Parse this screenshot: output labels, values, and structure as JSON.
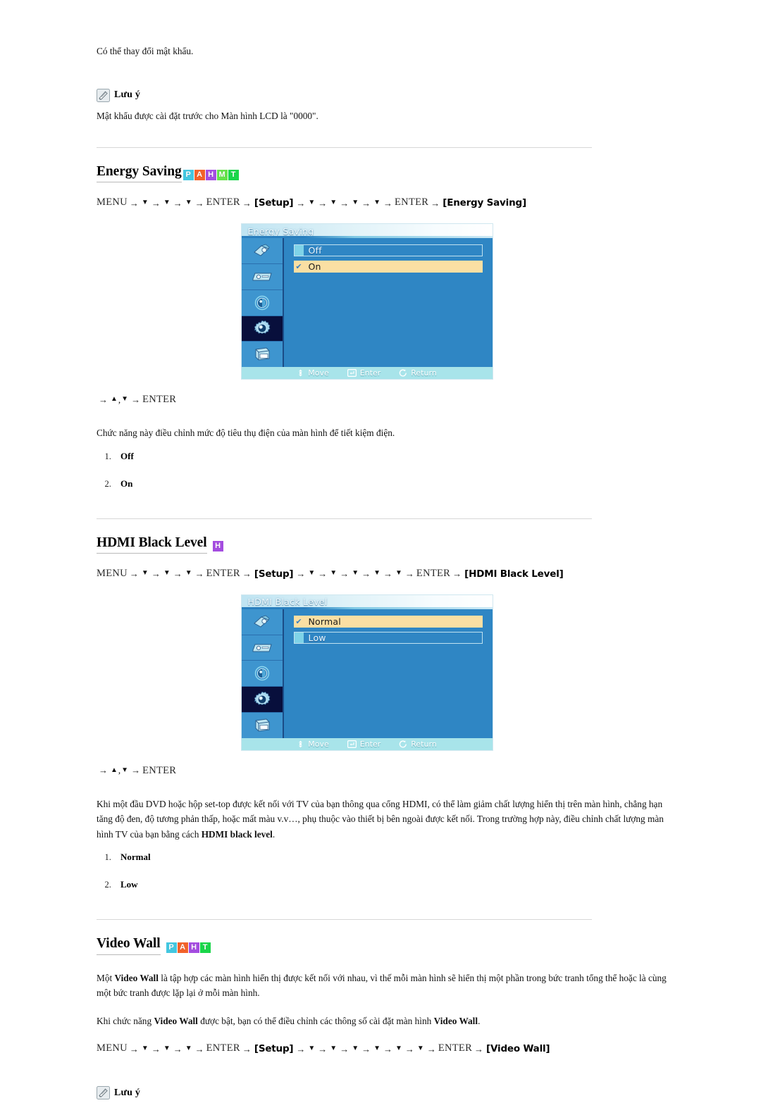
{
  "intro": {
    "line": "Có thể thay đổi mật khẩu."
  },
  "note_top": {
    "icon": "note-pencil-icon",
    "label": "Lưu ý",
    "body": "Mật khẩu được cài đặt trước cho Màn hình LCD là \"0000\"."
  },
  "sections": [
    {
      "id": "energy-saving",
      "title": "Energy Saving",
      "badges": [
        {
          "letter": "P",
          "color": "#43c7e0"
        },
        {
          "letter": "A",
          "color": "#f2622a"
        },
        {
          "letter": "H",
          "color": "#a44ce0"
        },
        {
          "letter": "M",
          "color": "#64e24a"
        },
        {
          "letter": "T",
          "color": "#1ad64a"
        }
      ],
      "menu_path": {
        "start": "MENU",
        "arrow": "→",
        "down": "▼",
        "down_count_1": 3,
        "enter": "ENTER",
        "osd_1": "[Setup]",
        "down_count_2": 4,
        "enter_2": "ENTER",
        "osd_2": "[Energy Saving]"
      },
      "osd": {
        "title": "Energy Saving",
        "rows": [
          {
            "label": "Off",
            "selected": false
          },
          {
            "label": "On",
            "selected": true
          }
        ],
        "footer": [
          {
            "icon": "move-icon",
            "label": "Move"
          },
          {
            "icon": "enter-icon",
            "label": "Enter"
          },
          {
            "icon": "return-icon",
            "label": "Return"
          }
        ],
        "side_icons": [
          "picture-icon",
          "sound-icon",
          "setup-circle-icon",
          "gear-icon",
          "multicontrol-icon"
        ],
        "active_side_index": 3
      },
      "short_path": {
        "arrow": "→",
        "up": "▲",
        "comma": ",",
        "down": "▼",
        "enter": "ENTER"
      },
      "description": "Chức năng này điều chỉnh mức độ tiêu thụ điện của màn hình để tiết kiệm điện.",
      "options": [
        "Off",
        "On"
      ]
    },
    {
      "id": "hdmi-black-level",
      "title": "HDMI Black Level",
      "badges": [
        {
          "letter": "H",
          "color": "#a44ce0"
        }
      ],
      "menu_path": {
        "start": "MENU",
        "arrow": "→",
        "down": "▼",
        "down_count_1": 3,
        "enter": "ENTER",
        "osd_1": "[Setup]",
        "down_count_2": 5,
        "enter_2": "ENTER",
        "osd_2": "[HDMI Black Level]"
      },
      "osd": {
        "title": "HDMI Black Level",
        "rows": [
          {
            "label": "Normal",
            "selected": true
          },
          {
            "label": "Low",
            "selected": false
          }
        ],
        "footer": [
          {
            "icon": "move-icon",
            "label": "Move"
          },
          {
            "icon": "enter-icon",
            "label": "Enter"
          },
          {
            "icon": "return-icon",
            "label": "Return"
          }
        ],
        "side_icons": [
          "picture-icon",
          "sound-icon",
          "setup-circle-icon",
          "gear-icon",
          "multicontrol-icon"
        ],
        "active_side_index": 3
      },
      "short_path": {
        "arrow": "→",
        "up": "▲",
        "comma": ",",
        "down": "▼",
        "enter": "ENTER"
      },
      "description_part1": "Khi một đầu DVD hoặc hộp set-top được kết nối với TV của bạn thông qua cổng HDMI, có thể làm giảm chất lượng hiển thị trên màn hình, chẳng hạn tăng độ đen, độ tương phản thấp, hoặc mất màu v.v…, phụ thuộc vào thiết bị bên ngoài được kết nối. Trong trường hợp này, điều chỉnh chất lượng màn hình TV của bạn bằng cách ",
      "description_bold": "HDMI black level",
      "description_part2": ".",
      "options": [
        "Normal",
        "Low"
      ]
    },
    {
      "id": "video-wall",
      "title": "Video Wall",
      "badges": [
        {
          "letter": "P",
          "color": "#43c7e0"
        },
        {
          "letter": "A",
          "color": "#f2622a"
        },
        {
          "letter": "H",
          "color": "#a44ce0"
        },
        {
          "letter": "T",
          "color": "#1ad64a"
        }
      ],
      "paragraph1_part1": "Một ",
      "paragraph1_bold": "Video Wall",
      "paragraph1_part2": " là tập hợp các màn hình hiển thị được kết nối với nhau, vì thế mỗi màn hình sẽ hiển thị một phần trong bức tranh tổng thể hoặc là cùng một bức tranh được lặp lại ở mỗi màn hình.",
      "paragraph2_part1": "Khi chức năng ",
      "paragraph2_bold1": "Video Wall",
      "paragraph2_part2": " được bật, bạn có thể điều chỉnh các thông số cài đặt màn hình ",
      "paragraph2_bold2": "Video Wall",
      "paragraph2_part3": ".",
      "menu_path": {
        "start": "MENU",
        "arrow": "→",
        "down": "▼",
        "down_count_1": 3,
        "enter": "ENTER",
        "osd_1": "[Setup]",
        "down_count_2": 6,
        "enter_2": "ENTER",
        "osd_2": "[Video Wall]"
      }
    }
  ],
  "note_bottom": {
    "icon": "note-pencil-icon",
    "label": "Lưu ý"
  }
}
